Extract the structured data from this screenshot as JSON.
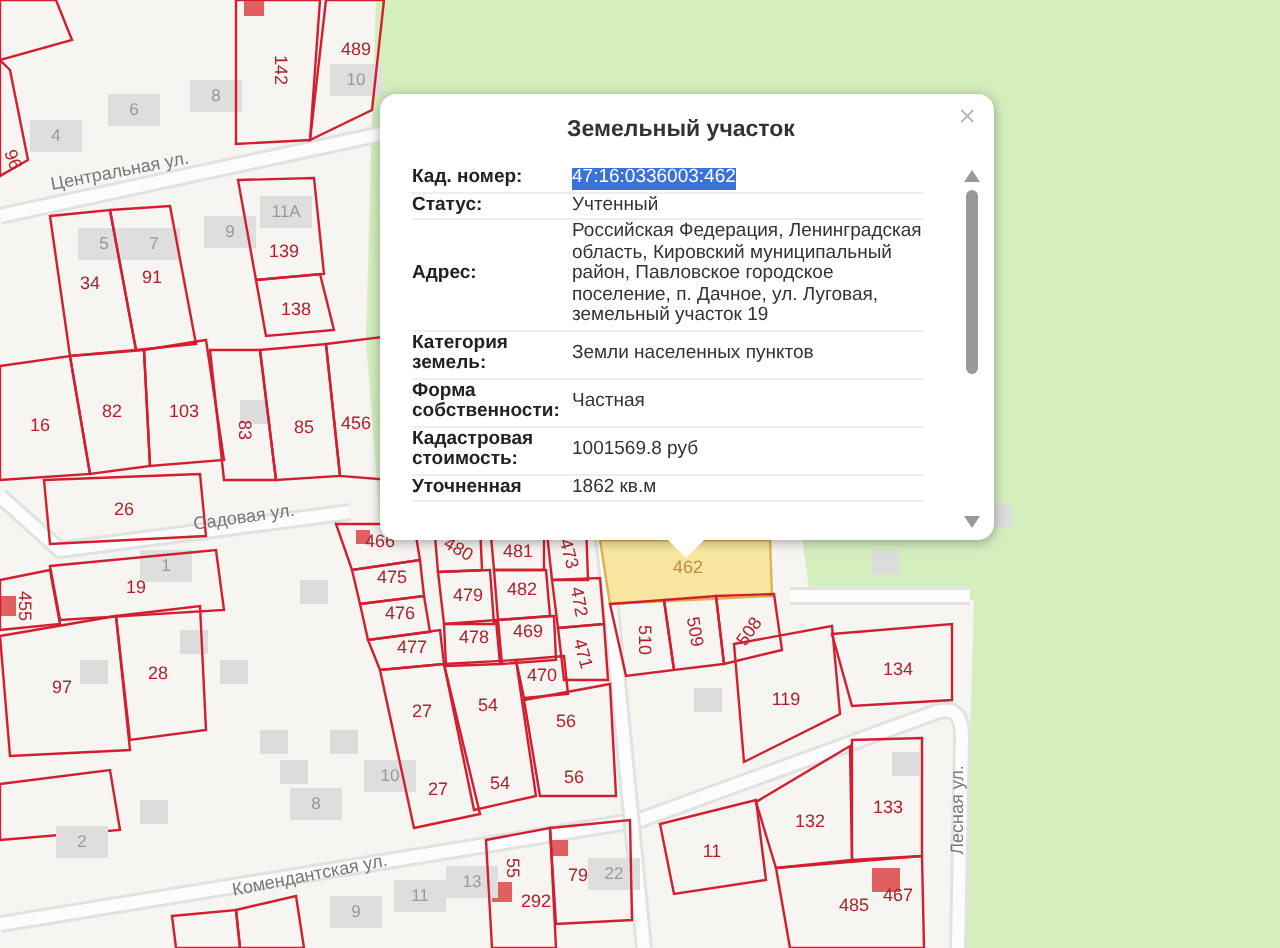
{
  "map": {
    "streets": [
      {
        "name": "Центральная ул."
      },
      {
        "name": "Садовая ул."
      },
      {
        "name": "Комендантская ул."
      },
      {
        "name": "Лесная ул."
      }
    ],
    "parcels": [
      {
        "label": "142",
        "selected": false
      },
      {
        "label": "489",
        "selected": false
      },
      {
        "label": "96",
        "selected": false
      },
      {
        "label": "34",
        "selected": false
      },
      {
        "label": "91",
        "selected": false
      },
      {
        "label": "139",
        "selected": false
      },
      {
        "label": "138",
        "selected": false
      },
      {
        "label": "16",
        "selected": false
      },
      {
        "label": "82",
        "selected": false
      },
      {
        "label": "103",
        "selected": false
      },
      {
        "label": "83",
        "selected": false
      },
      {
        "label": "85",
        "selected": false
      },
      {
        "label": "456",
        "selected": false
      },
      {
        "label": "26",
        "selected": false
      },
      {
        "label": "19",
        "selected": false
      },
      {
        "label": "455",
        "selected": false
      },
      {
        "label": "97",
        "selected": false
      },
      {
        "label": "28",
        "selected": false
      },
      {
        "label": "466",
        "selected": false
      },
      {
        "label": "475",
        "selected": false
      },
      {
        "label": "476",
        "selected": false
      },
      {
        "label": "477",
        "selected": false
      },
      {
        "label": "480",
        "selected": false
      },
      {
        "label": "481",
        "selected": false
      },
      {
        "label": "473",
        "selected": false
      },
      {
        "label": "479",
        "selected": false
      },
      {
        "label": "482",
        "selected": false
      },
      {
        "label": "472",
        "selected": false
      },
      {
        "label": "478",
        "selected": false
      },
      {
        "label": "469",
        "selected": false
      },
      {
        "label": "471",
        "selected": false
      },
      {
        "label": "470",
        "selected": false
      },
      {
        "label": "27",
        "selected": false
      },
      {
        "label": "54",
        "selected": false
      },
      {
        "label": "56",
        "selected": false
      },
      {
        "label": "27",
        "selected": false
      },
      {
        "label": "54",
        "selected": false
      },
      {
        "label": "56",
        "selected": false
      },
      {
        "label": "462",
        "selected": true
      },
      {
        "label": "510",
        "selected": false
      },
      {
        "label": "509",
        "selected": false
      },
      {
        "label": "508",
        "selected": false
      },
      {
        "label": "134",
        "selected": false
      },
      {
        "label": "119",
        "selected": false
      },
      {
        "label": "132",
        "selected": false
      },
      {
        "label": "133",
        "selected": false
      },
      {
        "label": "11",
        "selected": false
      },
      {
        "label": "485",
        "selected": false
      },
      {
        "label": "467",
        "selected": false
      },
      {
        "label": "55",
        "selected": false
      },
      {
        "label": "292",
        "selected": false
      },
      {
        "label": "79",
        "selected": false
      }
    ],
    "houses": [
      {
        "label": "10"
      },
      {
        "label": "8"
      },
      {
        "label": "6"
      },
      {
        "label": "4"
      },
      {
        "label": "5"
      },
      {
        "label": "7"
      },
      {
        "label": "9"
      },
      {
        "label": "11А"
      },
      {
        "label": "1"
      },
      {
        "label": "10"
      },
      {
        "label": "8"
      },
      {
        "label": "2"
      },
      {
        "label": "9"
      },
      {
        "label": "11"
      },
      {
        "label": "13"
      },
      {
        "label": "22"
      }
    ]
  },
  "popup": {
    "title": "Земельный участок",
    "close": "×",
    "rows": [
      {
        "label": "Кад. номер:",
        "value": "47:16:0336003:462",
        "selected": true
      },
      {
        "label": "Статус:",
        "value": "Учтенный",
        "selected": false
      },
      {
        "label": "Адрес:",
        "value": "Российская Федерация, Ленинградская область, Кировский муниципальный район, Павловское городское поселение, п. Дачное, ул. Луговая, земельный участок 19",
        "selected": false
      },
      {
        "label": "Категория земель:",
        "value": "Земли населенных пунктов",
        "selected": false
      },
      {
        "label": "Форма собственности:",
        "value": "Частная",
        "selected": false
      },
      {
        "label": "Кадастровая стоимость:",
        "value": "1001569.8 руб",
        "selected": false
      },
      {
        "label": "Уточненная",
        "value": "1862 кв.м",
        "selected": false
      }
    ]
  }
}
